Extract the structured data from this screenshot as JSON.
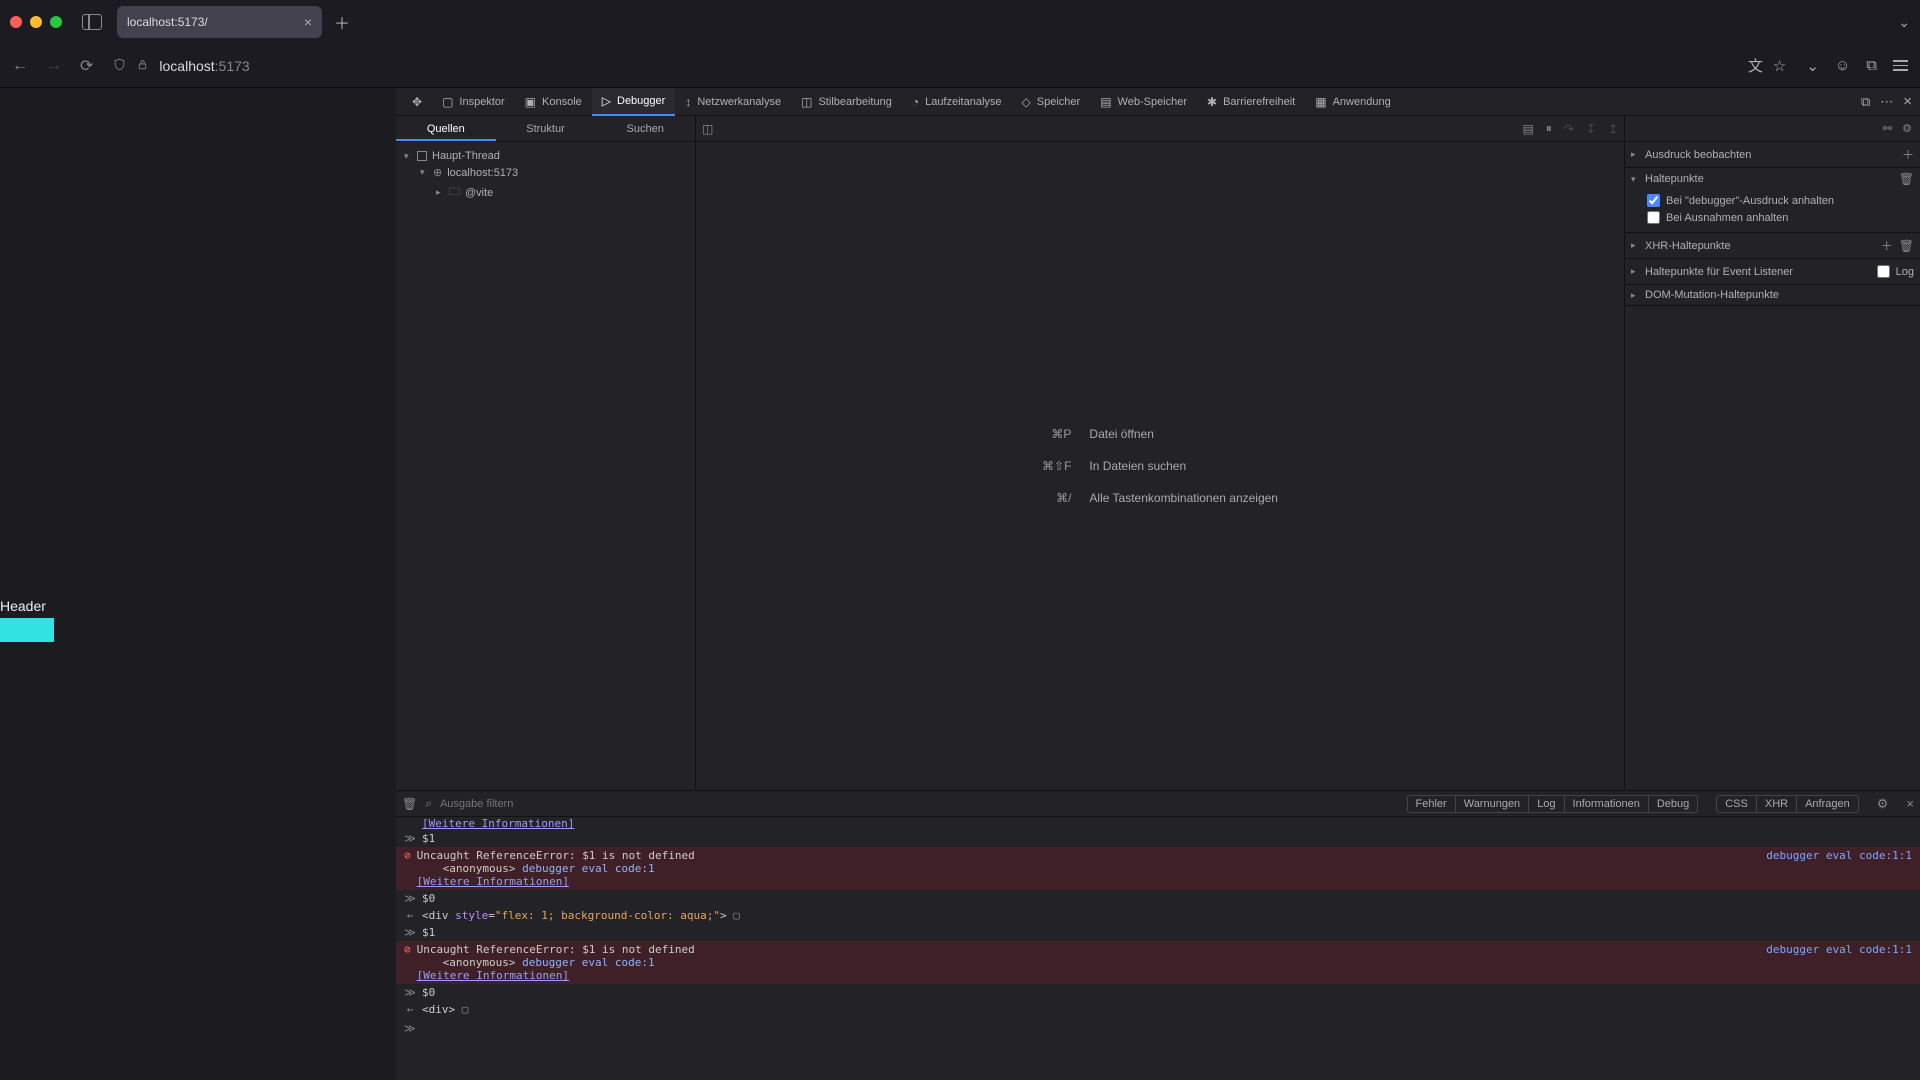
{
  "window": {
    "tab_title": "localhost:5173/",
    "url_host": "localhost",
    "url_port": ":5173"
  },
  "devtools_tabs": {
    "inspector": "Inspektor",
    "console": "Konsole",
    "debugger": "Debugger",
    "network": "Netzwerkanalyse",
    "style": "Stilbearbeitung",
    "perf": "Laufzeitanalyse",
    "memory": "Speicher",
    "storage": "Web-Speicher",
    "a11y": "Barrierefreiheit",
    "app": "Anwendung"
  },
  "sources": {
    "tab_quellen": "Quellen",
    "tab_struktur": "Struktur",
    "tab_suchen": "Suchen",
    "main_thread": "Haupt-Thread",
    "host": "localhost:5173",
    "vite": "@vite"
  },
  "editor_shortcuts": {
    "k1": "⌘P",
    "l1": "Datei öffnen",
    "k2": "⌘⇧F",
    "l2": "In Dateien suchen",
    "k3": "⌘/",
    "l3": "Alle Tastenkombinationen anzeigen"
  },
  "side": {
    "watch": "Ausdruck beobachten",
    "breakpoints": "Haltepunkte",
    "bp_debugger": "Bei \"debugger\"-Ausdruck anhalten",
    "bp_exceptions": "Bei Ausnahmen anhalten",
    "xhr": "XHR-Haltepunkte",
    "event": "Haltepunkte für Event Listener",
    "event_log": "Log",
    "dom": "DOM-Mutation-Haltepunkte"
  },
  "console_toolbar": {
    "filter_placeholder": "Ausgabe filtern",
    "pills": [
      "Fehler",
      "Warnungen",
      "Log",
      "Informationen",
      "Debug"
    ],
    "pills2": [
      "CSS",
      "XHR",
      "Anfragen"
    ]
  },
  "console": {
    "more_info": "[Weitere Informationen]",
    "in1": "$1",
    "err1_msg": "Uncaught ReferenceError: $1 is not defined",
    "err_anon": "<anonymous>",
    "err_src": "debugger eval code:1",
    "err_loc": "debugger eval code:1:1",
    "in2": "$0",
    "out2_pre": "<div ",
    "out2_style_key": "style",
    "out2_style_val": "\"flex: 1; background-color: aqua;\"",
    "out2_post": ">",
    "in3": "$1",
    "in4": "$0",
    "out4": "<div>"
  },
  "page": {
    "header": "Header"
  }
}
